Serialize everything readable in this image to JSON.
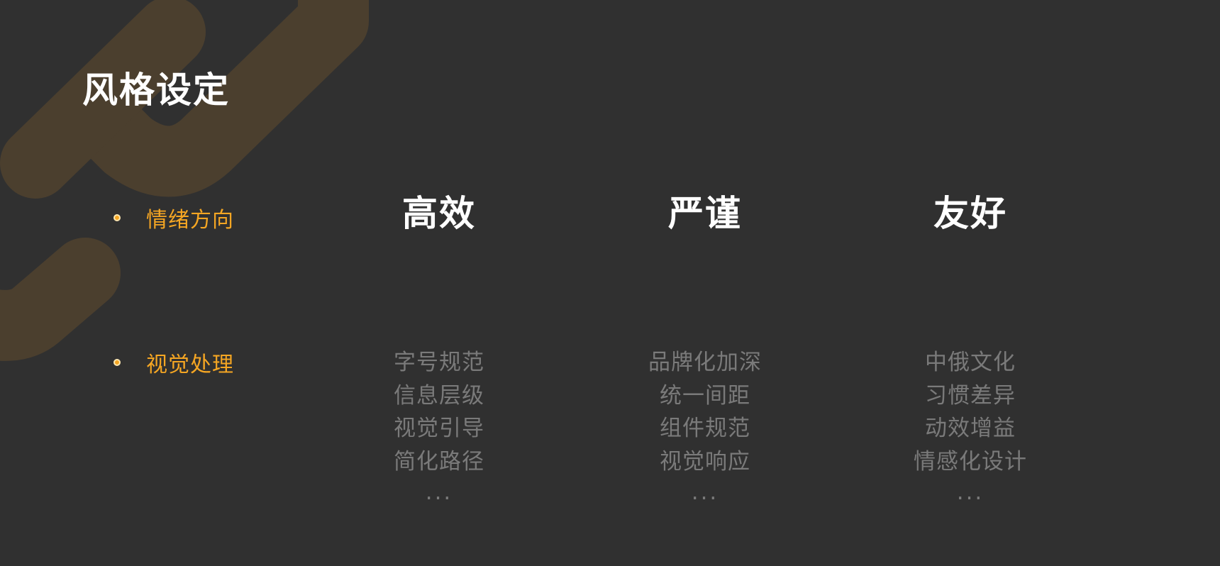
{
  "slide": {
    "title": "风格设定",
    "rows": {
      "emotion_label": "情绪方向",
      "visual_label": "视觉处理"
    },
    "columns": [
      {
        "heading": "高效",
        "items": [
          "字号规范",
          "信息层级",
          "视觉引导",
          "简化路径",
          "..."
        ]
      },
      {
        "heading": "严谨",
        "items": [
          "品牌化加深",
          "统一间距",
          "组件规范",
          "视觉响应",
          "..."
        ]
      },
      {
        "heading": "友好",
        "items": [
          "中俄文化",
          "习惯差异",
          "动效增益",
          "情感化设计",
          "..."
        ]
      }
    ]
  },
  "colors": {
    "background": "#303030",
    "accent": "#f5a623",
    "decoration": "#4b3f2e",
    "heading": "#ffffff",
    "muted_text": "#7a7a7a"
  }
}
